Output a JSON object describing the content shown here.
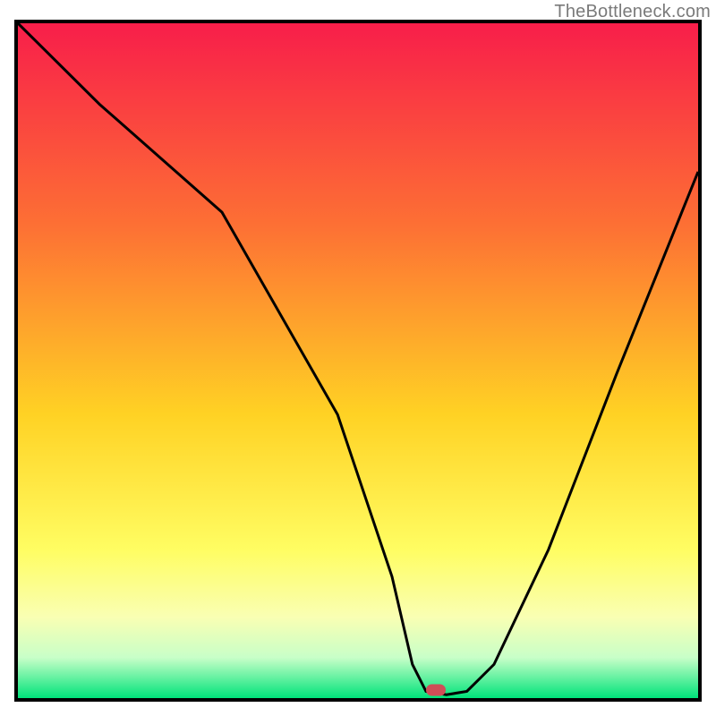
{
  "watermark": "TheBottleneck.com",
  "colors": {
    "top": "#f81e4a",
    "mid1": "#fd7034",
    "mid2": "#ffd224",
    "mid3": "#fffd62",
    "mid4": "#f9ffb3",
    "mid5": "#c8ffc8",
    "bottom": "#00e37a",
    "line": "#000000",
    "marker": "#cf4e57"
  },
  "marker_position": {
    "x_pct": 61.5,
    "y_pct": 98.8
  },
  "chart_data": {
    "type": "line",
    "title": "",
    "xlabel": "",
    "ylabel": "",
    "xlim": [
      0,
      100
    ],
    "ylim": [
      0,
      100
    ],
    "series": [
      {
        "name": "curve",
        "x": [
          0,
          12,
          30,
          47,
          55,
          58,
          60,
          63,
          66,
          70,
          78,
          88,
          100
        ],
        "values": [
          100,
          88,
          72,
          42,
          18,
          5,
          1,
          0.5,
          1,
          5,
          22,
          48,
          78
        ]
      }
    ],
    "marker": {
      "x": 61.5,
      "y": 0.7
    },
    "gradient_background": true
  }
}
